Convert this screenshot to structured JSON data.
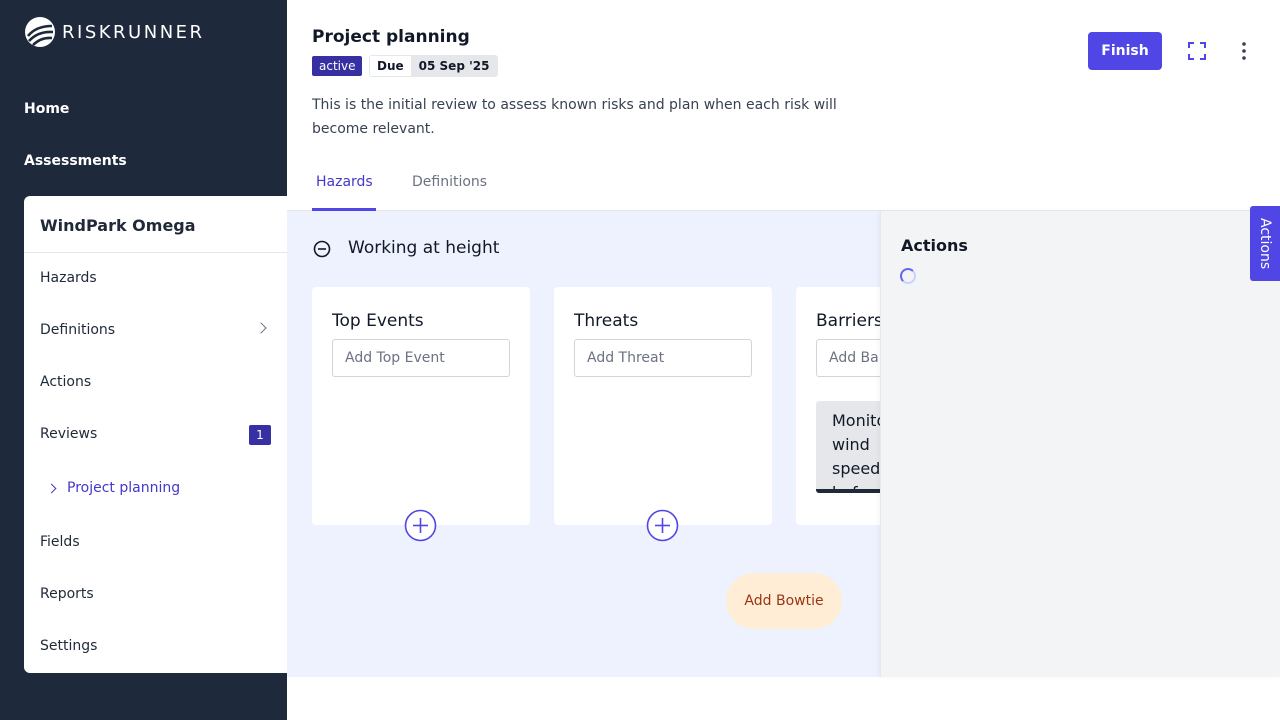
{
  "app": {
    "name": "RISKRUNNER"
  },
  "sidebar": {
    "home": "Home",
    "assessments": "Assessments",
    "project": {
      "title": "WindPark Omega",
      "items": [
        {
          "label": "Hazards"
        },
        {
          "label": "Definitions"
        },
        {
          "label": "Actions"
        },
        {
          "label": "Reviews",
          "badge": "1"
        },
        {
          "label": "Project planning"
        },
        {
          "label": "Fields"
        },
        {
          "label": "Reports"
        },
        {
          "label": "Settings"
        }
      ]
    }
  },
  "header": {
    "title": "Project planning",
    "status": "active",
    "due_label": "Due",
    "due_date": "05 Sep '25",
    "description": "This is the initial review to assess known risks and plan when each risk will become relevant.",
    "finish_label": "Finish"
  },
  "tabs": [
    {
      "label": "Hazards",
      "active": true
    },
    {
      "label": "Definitions",
      "active": false
    }
  ],
  "hazard": {
    "title": "Working at height",
    "columns": [
      {
        "title": "Top Events",
        "placeholder": "Add Top Event"
      },
      {
        "title": "Threats",
        "placeholder": "Add Threat"
      },
      {
        "title": "Barriers",
        "placeholder": "Add Barrier",
        "items": [
          "Monitor wind speed before work"
        ]
      }
    ],
    "add_bowtie_label": "Add Bowtie"
  },
  "actions_panel": {
    "title": "Actions",
    "tab_label": "Actions"
  },
  "colors": {
    "sidebar_bg": "#1e293b",
    "accent": "#4f46e5",
    "badge": "#3730a3",
    "main_bg": "#eef2ff",
    "bowtie_bg": "#ffedd5",
    "bowtie_text": "#9a3412"
  }
}
